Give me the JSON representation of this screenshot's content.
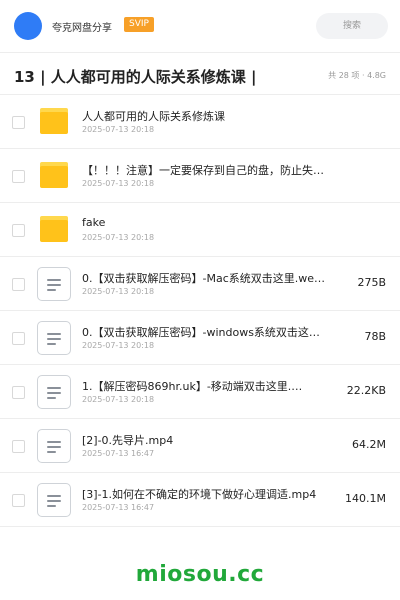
{
  "header": {
    "brand": "夸克网盘分享",
    "svip": "SVIP",
    "search_placeholder": "搜索"
  },
  "folder": {
    "title": "13 | 人人都可用的人际关系修炼课 |",
    "summary": "共 28 项 · 4.8G"
  },
  "items": [
    {
      "type": "folder",
      "name": "人人都可用的人际关系修炼课",
      "date": "2025-07-13 20:18",
      "size": ""
    },
    {
      "type": "folder",
      "name": "【！！！注意】一定要保存到自己的盘，防止失效！！！",
      "date": "2025-07-13 20:18",
      "size": ""
    },
    {
      "type": "folder",
      "name": "fake",
      "date": "2025-07-13 20:18",
      "size": ""
    },
    {
      "type": "file",
      "name": "0.【双击获取解压密码】-Mac系统双击这里.we…",
      "date": "2025-07-13 20:18",
      "size": "275B"
    },
    {
      "type": "file",
      "name": "0.【双击获取解压密码】-windows系统双击这…",
      "date": "2025-07-13 20:18",
      "size": "78B"
    },
    {
      "type": "file",
      "name": "1.【解压密码869hr.uk】-移动端双击这里.…",
      "date": "2025-07-13 20:18",
      "size": "22.2KB"
    },
    {
      "type": "file",
      "name": "[2]-0.先导片.mp4",
      "date": "2025-07-13 16:47",
      "size": "64.2M"
    },
    {
      "type": "file",
      "name": "[3]-1.如何在不确定的环境下做好心理调适.mp4",
      "date": "2025-07-13 16:47",
      "size": "140.1M"
    }
  ],
  "watermark": "miosou.cc",
  "colors": {
    "accent": "#2f7cf6",
    "svip": "#f7a028",
    "folder": "#ffc21a",
    "watermark": "#21a83a"
  }
}
